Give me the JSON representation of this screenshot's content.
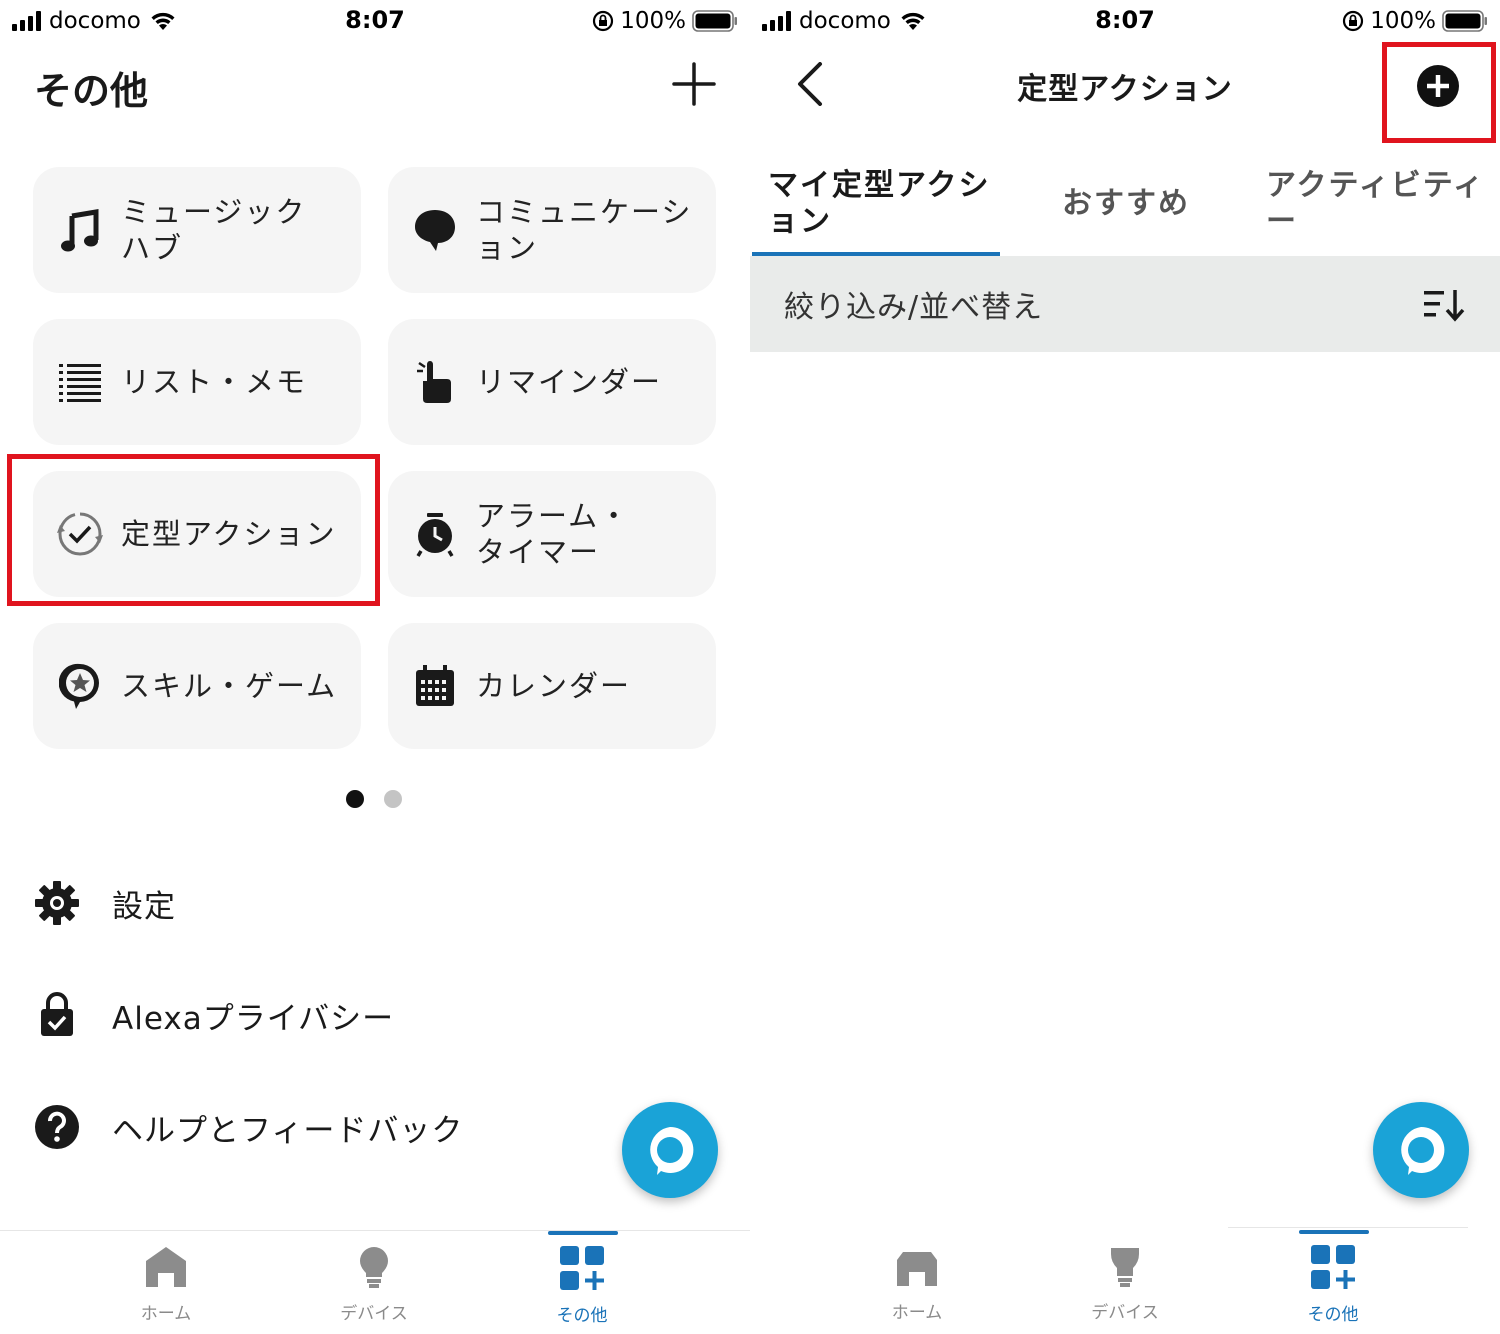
{
  "status_bar": {
    "carrier": "docomo",
    "time": "8:07",
    "battery": "100%"
  },
  "left": {
    "title": "その他",
    "tiles": [
      {
        "label": "ミュージック\nハブ",
        "icon": "music-note-icon"
      },
      {
        "label": "コミュニケーシ\nョン",
        "icon": "speech-bubble-icon"
      },
      {
        "label": "リスト・メモ",
        "icon": "list-icon"
      },
      {
        "label": "リマインダー",
        "icon": "finger-reminder-icon"
      },
      {
        "label": "定型アクション",
        "icon": "routine-check-icon"
      },
      {
        "label": "アラーム・\nタイマー",
        "icon": "alarm-clock-icon"
      },
      {
        "label": "スキル・ゲーム",
        "icon": "skill-star-icon"
      },
      {
        "label": "カレンダー",
        "icon": "calendar-icon"
      }
    ],
    "menu": [
      {
        "label": "設定",
        "icon": "gear-icon"
      },
      {
        "label": "Alexaプライバシー",
        "icon": "privacy-lock-icon"
      },
      {
        "label": "ヘルプとフィードバック",
        "icon": "help-icon"
      }
    ]
  },
  "right": {
    "title": "定型アクション",
    "tabs": [
      {
        "label": "マイ定型アクシ\nョン",
        "active": true
      },
      {
        "label": "おすすめ",
        "active": false
      },
      {
        "label": "アクティビティ\nー",
        "active": false
      }
    ],
    "filter_label": "絞り込み/並べ替え"
  },
  "nav": {
    "items": [
      {
        "label": "ホーム",
        "icon": "home-icon"
      },
      {
        "label": "デバイス",
        "icon": "bulb-icon"
      },
      {
        "label": "その他",
        "icon": "more-grid-icon",
        "active": true
      }
    ]
  },
  "colors": {
    "accent": "#1a73b8",
    "alexa": "#1aa3d7",
    "highlight": "#e0141e",
    "tile_bg": "#f5f5f5",
    "filter_bg": "#e9ebea"
  }
}
